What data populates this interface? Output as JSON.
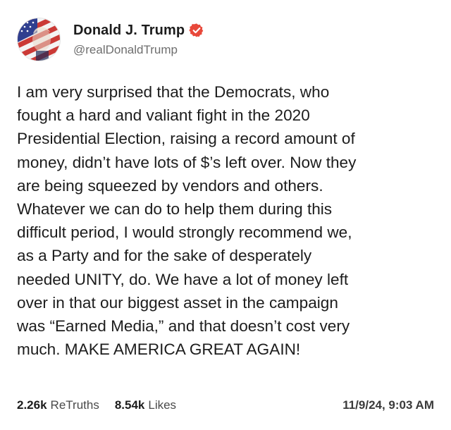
{
  "post": {
    "author": {
      "display_name": "Donald J. Trump",
      "handle": "@realDonaldTrump",
      "verified_icon": "verified-badge-icon",
      "avatar_icon": "profile-avatar"
    },
    "text": "I am very surprised that the Democrats, who\nfought a hard and valiant fight in the 2020\nPresidential Election, raising a record amount of\nmoney, didn’t have lots of $’s left over. Now they\nare being squeezed by vendors and others.\nWhatever we can do to help them during this\ndifficult period, I would strongly recommend we,\nas a Party and for the sake of desperately\nneeded UNITY, do. We have a lot of money left\nover in that our biggest asset in the campaign\nwas “Earned Media,” and that doesn’t cost very\nmuch. MAKE AMERICA GREAT AGAIN!",
    "stats": {
      "retruths_count": "2.26k",
      "retruths_label": "ReTruths",
      "likes_count": "8.54k",
      "likes_label": "Likes"
    },
    "timestamp": "11/9/24, 9:03 AM"
  },
  "colors": {
    "verified_badge": "#e8483a",
    "text": "#1c1c1c",
    "muted": "#6e6e6e"
  }
}
